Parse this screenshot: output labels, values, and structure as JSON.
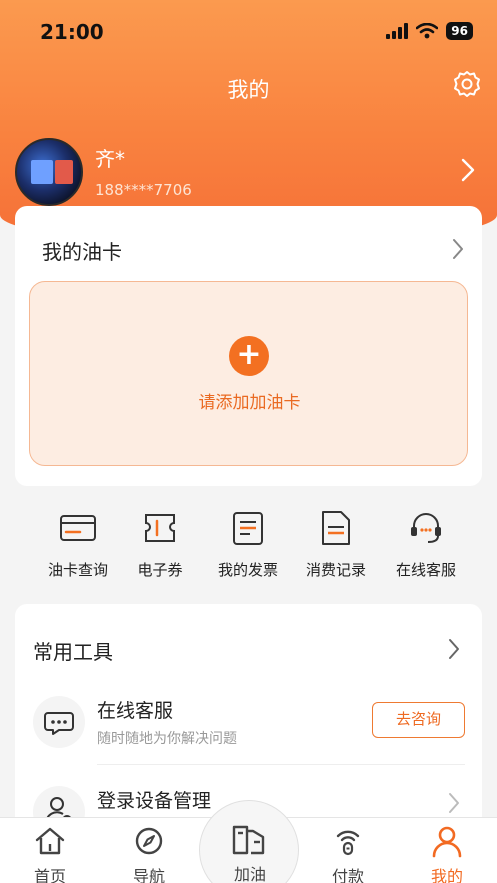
{
  "status": {
    "time": "21:00",
    "battery": "96"
  },
  "header": {
    "title": "我的"
  },
  "profile": {
    "name": "齐*",
    "phone": "188****7706"
  },
  "oil_card": {
    "title": "我的油卡",
    "add_label": "请添加加油卡"
  },
  "shortcuts": [
    {
      "label": "油卡查询",
      "icon": "card-icon"
    },
    {
      "label": "电子券",
      "icon": "ticket-icon"
    },
    {
      "label": "我的发票",
      "icon": "invoice-icon"
    },
    {
      "label": "消费记录",
      "icon": "record-icon"
    },
    {
      "label": "在线客服",
      "icon": "headset-icon"
    }
  ],
  "tools": {
    "title": "常用工具",
    "items": [
      {
        "title": "在线客服",
        "subtitle": "随时随地为你解决问题",
        "action": "去咨询",
        "icon": "chat-icon"
      },
      {
        "title": "登录设备管理",
        "icon": "user-device-icon"
      }
    ]
  },
  "tabbar": [
    {
      "label": "首页",
      "icon": "home-icon"
    },
    {
      "label": "导航",
      "icon": "compass-icon"
    },
    {
      "label": "加油",
      "icon": "fuel-icon"
    },
    {
      "label": "付款",
      "icon": "pay-icon"
    },
    {
      "label": "我的",
      "icon": "person-icon",
      "active": true
    }
  ],
  "colors": {
    "accent": "#F37021",
    "header_start": "#FB9A4F",
    "header_end": "#F56F37"
  }
}
